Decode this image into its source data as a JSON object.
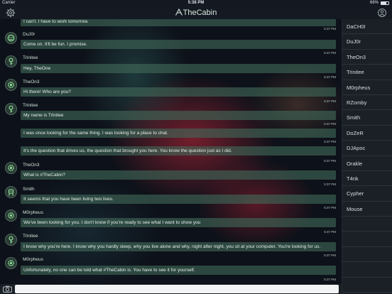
{
  "status_bar": {
    "carrier": "Carrier",
    "time": "5:38 PM",
    "battery_text": "66%",
    "battery_level": 0.66
  },
  "nav": {
    "title": "TheCabin"
  },
  "messages": [
    {
      "name": "",
      "text": "I can't. I have to work tomorrow.",
      "time": "5:37 PM"
    },
    {
      "name": "DuJ0r",
      "text": "Come on. It'll be fun. I promise.",
      "time": "5:37 PM",
      "avatar_icon": "face-icon"
    },
    {
      "name": "Trinitee",
      "text": "Hey, TheOne",
      "time": "5:37 PM",
      "avatar_icon": "key-icon"
    },
    {
      "name": "TheOn3",
      "text": "Hi there! Who are you?",
      "time": "5:37 PM",
      "avatar_icon": "gear-face-icon"
    },
    {
      "name": "Trinitee",
      "text": "My name is Trinitee",
      "time": "5:37 PM",
      "avatar_icon": "key-icon"
    },
    {
      "name": "",
      "text": "I was once looking for the same thing. I was looking for a place to chat.",
      "time": "5:37 PM"
    },
    {
      "name": "",
      "text": "It's the question that drives us, the question that brought you here. You know the question just as I did.",
      "time": "5:37 PM"
    },
    {
      "name": "TheOn3",
      "text": "What is #TheCabin?",
      "time": "5:37 PM",
      "avatar_icon": "gear-face-icon"
    },
    {
      "name": "Smith",
      "text": "It seems that you have been living two lives.",
      "time": "5:37 PM",
      "avatar_icon": "robot-icon"
    },
    {
      "name": "M0rpheus",
      "text": "We've been looking for you. I don't know if you're ready to see what I want to show you",
      "time": "5:37 PM",
      "avatar_icon": "gear-face-icon"
    },
    {
      "name": "Trinitee",
      "text": "I know why you're here. I know why you hardly sleep, why you live alone and why, night after night, you sit at your computer. You're looking for us.",
      "time": "5:37 PM",
      "avatar_icon": "key-icon"
    },
    {
      "name": "M0rpheus",
      "text": "Unfortunately, no one can be told what #TheCabin is. You have to see it for yourself.",
      "time": "5:37 PM",
      "avatar_icon": "gear-face-icon"
    }
  ],
  "input": {
    "placeholder": ""
  },
  "users": [
    "DaCH0I",
    "DuJ0r",
    "TheOn3",
    "Trinitee",
    "M0rpheus",
    "RZomby",
    "Smith",
    "DoZeR",
    "DJApoc",
    "Orakle",
    "T4nk",
    "Cypher",
    "Mouse",
    "",
    "",
    "",
    "",
    ""
  ],
  "colors": {
    "accent": "#8fe39a",
    "bubble": "#406958",
    "panel": "#1b2027"
  }
}
